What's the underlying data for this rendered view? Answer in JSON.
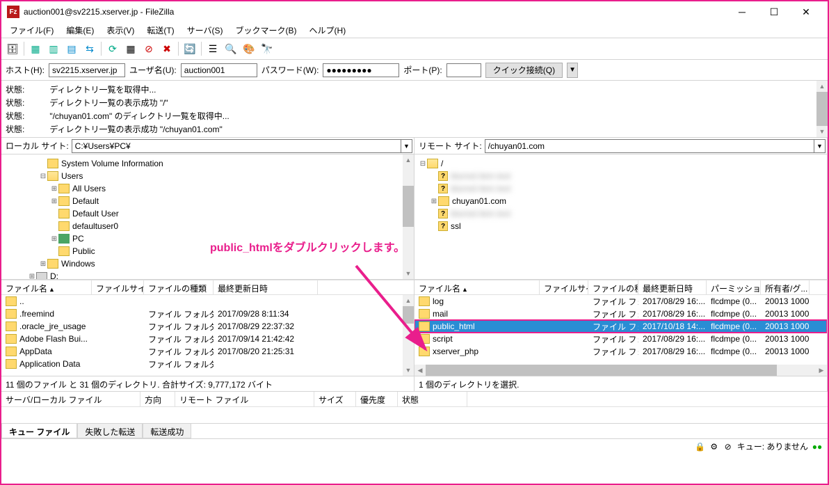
{
  "window": {
    "title": "auction001@sv2215.xserver.jp - FileZilla",
    "icon_text": "Fz"
  },
  "menus": [
    "ファイル(F)",
    "編集(E)",
    "表示(V)",
    "転送(T)",
    "サーバ(S)",
    "ブックマーク(B)",
    "ヘルプ(H)"
  ],
  "quickconnect": {
    "host_label": "ホスト(H):",
    "host": "sv2215.xserver.jp",
    "user_label": "ユーザ名(U):",
    "user": "auction001",
    "pass_label": "パスワード(W):",
    "pass": "●●●●●●●●●",
    "port_label": "ポート(P):",
    "port": "",
    "button": "クイック接続(Q)"
  },
  "log": [
    {
      "label": "状態:",
      "msg": "ディレクトリ一覧を取得中..."
    },
    {
      "label": "状態:",
      "msg": "ディレクトリ一覧の表示成功 \"/\""
    },
    {
      "label": "状態:",
      "msg": "\"/chuyan01.com\" のディレクトリ一覧を取得中..."
    },
    {
      "label": "状態:",
      "msg": "ディレクトリ一覧の表示成功 \"/chuyan01.com\""
    }
  ],
  "local": {
    "site_label": "ローカル サイト:",
    "path": "C:¥Users¥PC¥",
    "tree": [
      {
        "depth": 3,
        "toggle": "",
        "name": "System Volume Information",
        "icon": "folder"
      },
      {
        "depth": 3,
        "toggle": "⊟",
        "name": "Users",
        "icon": "folder-open"
      },
      {
        "depth": 4,
        "toggle": "⊞",
        "name": "All Users",
        "icon": "folder"
      },
      {
        "depth": 4,
        "toggle": "⊞",
        "name": "Default",
        "icon": "folder"
      },
      {
        "depth": 4,
        "toggle": "",
        "name": "Default User",
        "icon": "folder"
      },
      {
        "depth": 4,
        "toggle": "",
        "name": "defaultuser0",
        "icon": "folder"
      },
      {
        "depth": 4,
        "toggle": "⊞",
        "name": "PC",
        "icon": "pc"
      },
      {
        "depth": 4,
        "toggle": "",
        "name": "Public",
        "icon": "folder"
      },
      {
        "depth": 3,
        "toggle": "⊞",
        "name": "Windows",
        "icon": "folder"
      },
      {
        "depth": 2,
        "toggle": "⊞",
        "name": "D:",
        "icon": "drive"
      }
    ],
    "columns": [
      "ファイル名",
      "ファイルサイズ",
      "ファイルの種類",
      "最終更新日時"
    ],
    "files": [
      {
        "name": "..",
        "size": "",
        "type": "",
        "date": ""
      },
      {
        "name": ".freemind",
        "size": "",
        "type": "ファイル フォルダー",
        "date": "2017/09/28 8:11:34"
      },
      {
        "name": ".oracle_jre_usage",
        "size": "",
        "type": "ファイル フォルダー",
        "date": "2017/08/29 22:37:32"
      },
      {
        "name": "Adobe Flash Bui...",
        "size": "",
        "type": "ファイル フォルダー",
        "date": "2017/09/14 21:42:42"
      },
      {
        "name": "AppData",
        "size": "",
        "type": "ファイル フォルダー",
        "date": "2017/08/20 21:25:31"
      },
      {
        "name": "Application Data",
        "size": "",
        "type": "ファイル フォルダー",
        "date": ""
      }
    ],
    "status": "11 個のファイル と 31 個のディレクトリ. 合計サイズ: 9,777,172 バイト"
  },
  "remote": {
    "site_label": "リモート サイト:",
    "path": "/chuyan01.com",
    "tree": [
      {
        "depth": 0,
        "toggle": "⊟",
        "name": "/",
        "icon": "folder-open"
      },
      {
        "depth": 1,
        "toggle": "",
        "name": "blurred1",
        "icon": "q",
        "blur": true
      },
      {
        "depth": 1,
        "toggle": "",
        "name": "blurred2",
        "icon": "q",
        "blur": true
      },
      {
        "depth": 1,
        "toggle": "⊞",
        "name": "chuyan01.com",
        "icon": "folder"
      },
      {
        "depth": 1,
        "toggle": "",
        "name": "blurred3",
        "icon": "q",
        "blur": true
      },
      {
        "depth": 1,
        "toggle": "",
        "name": "ssl",
        "icon": "q"
      }
    ],
    "columns": [
      "ファイル名",
      "ファイルサイズ",
      "ファイルの種類",
      "最終更新日時",
      "パーミッション",
      "所有者/グ..."
    ],
    "files": [
      {
        "name": "log",
        "size": "",
        "type": "ファイル フォ...",
        "date": "2017/08/29 16:...",
        "perm": "flcdmpe (0...",
        "owner": "20013 1000"
      },
      {
        "name": "mail",
        "size": "",
        "type": "ファイル フォ...",
        "date": "2017/08/29 16:...",
        "perm": "flcdmpe (0...",
        "owner": "20013 1000"
      },
      {
        "name": "public_html",
        "size": "",
        "type": "ファイル フォ...",
        "date": "2017/10/18 14:...",
        "perm": "flcdmpe (0...",
        "owner": "20013 1000",
        "selected": true
      },
      {
        "name": "script",
        "size": "",
        "type": "ファイル フォ...",
        "date": "2017/08/29 16:...",
        "perm": "flcdmpe (0...",
        "owner": "20013 1000"
      },
      {
        "name": "xserver_php",
        "size": "",
        "type": "ファイル フォ...",
        "date": "2017/08/29 16:...",
        "perm": "flcdmpe (0...",
        "owner": "20013 1000"
      }
    ],
    "status": "1 個のディレクトリを選択."
  },
  "queue": {
    "columns": [
      "サーバ/ローカル ファイル",
      "方向",
      "リモート ファイル",
      "サイズ",
      "優先度",
      "状態"
    ]
  },
  "tabs": [
    "キュー ファイル",
    "失敗した転送",
    "転送成功"
  ],
  "statusbar": {
    "queue_label": "キュー: ありません"
  },
  "annotation": "public_htmlをダブルクリックします。"
}
